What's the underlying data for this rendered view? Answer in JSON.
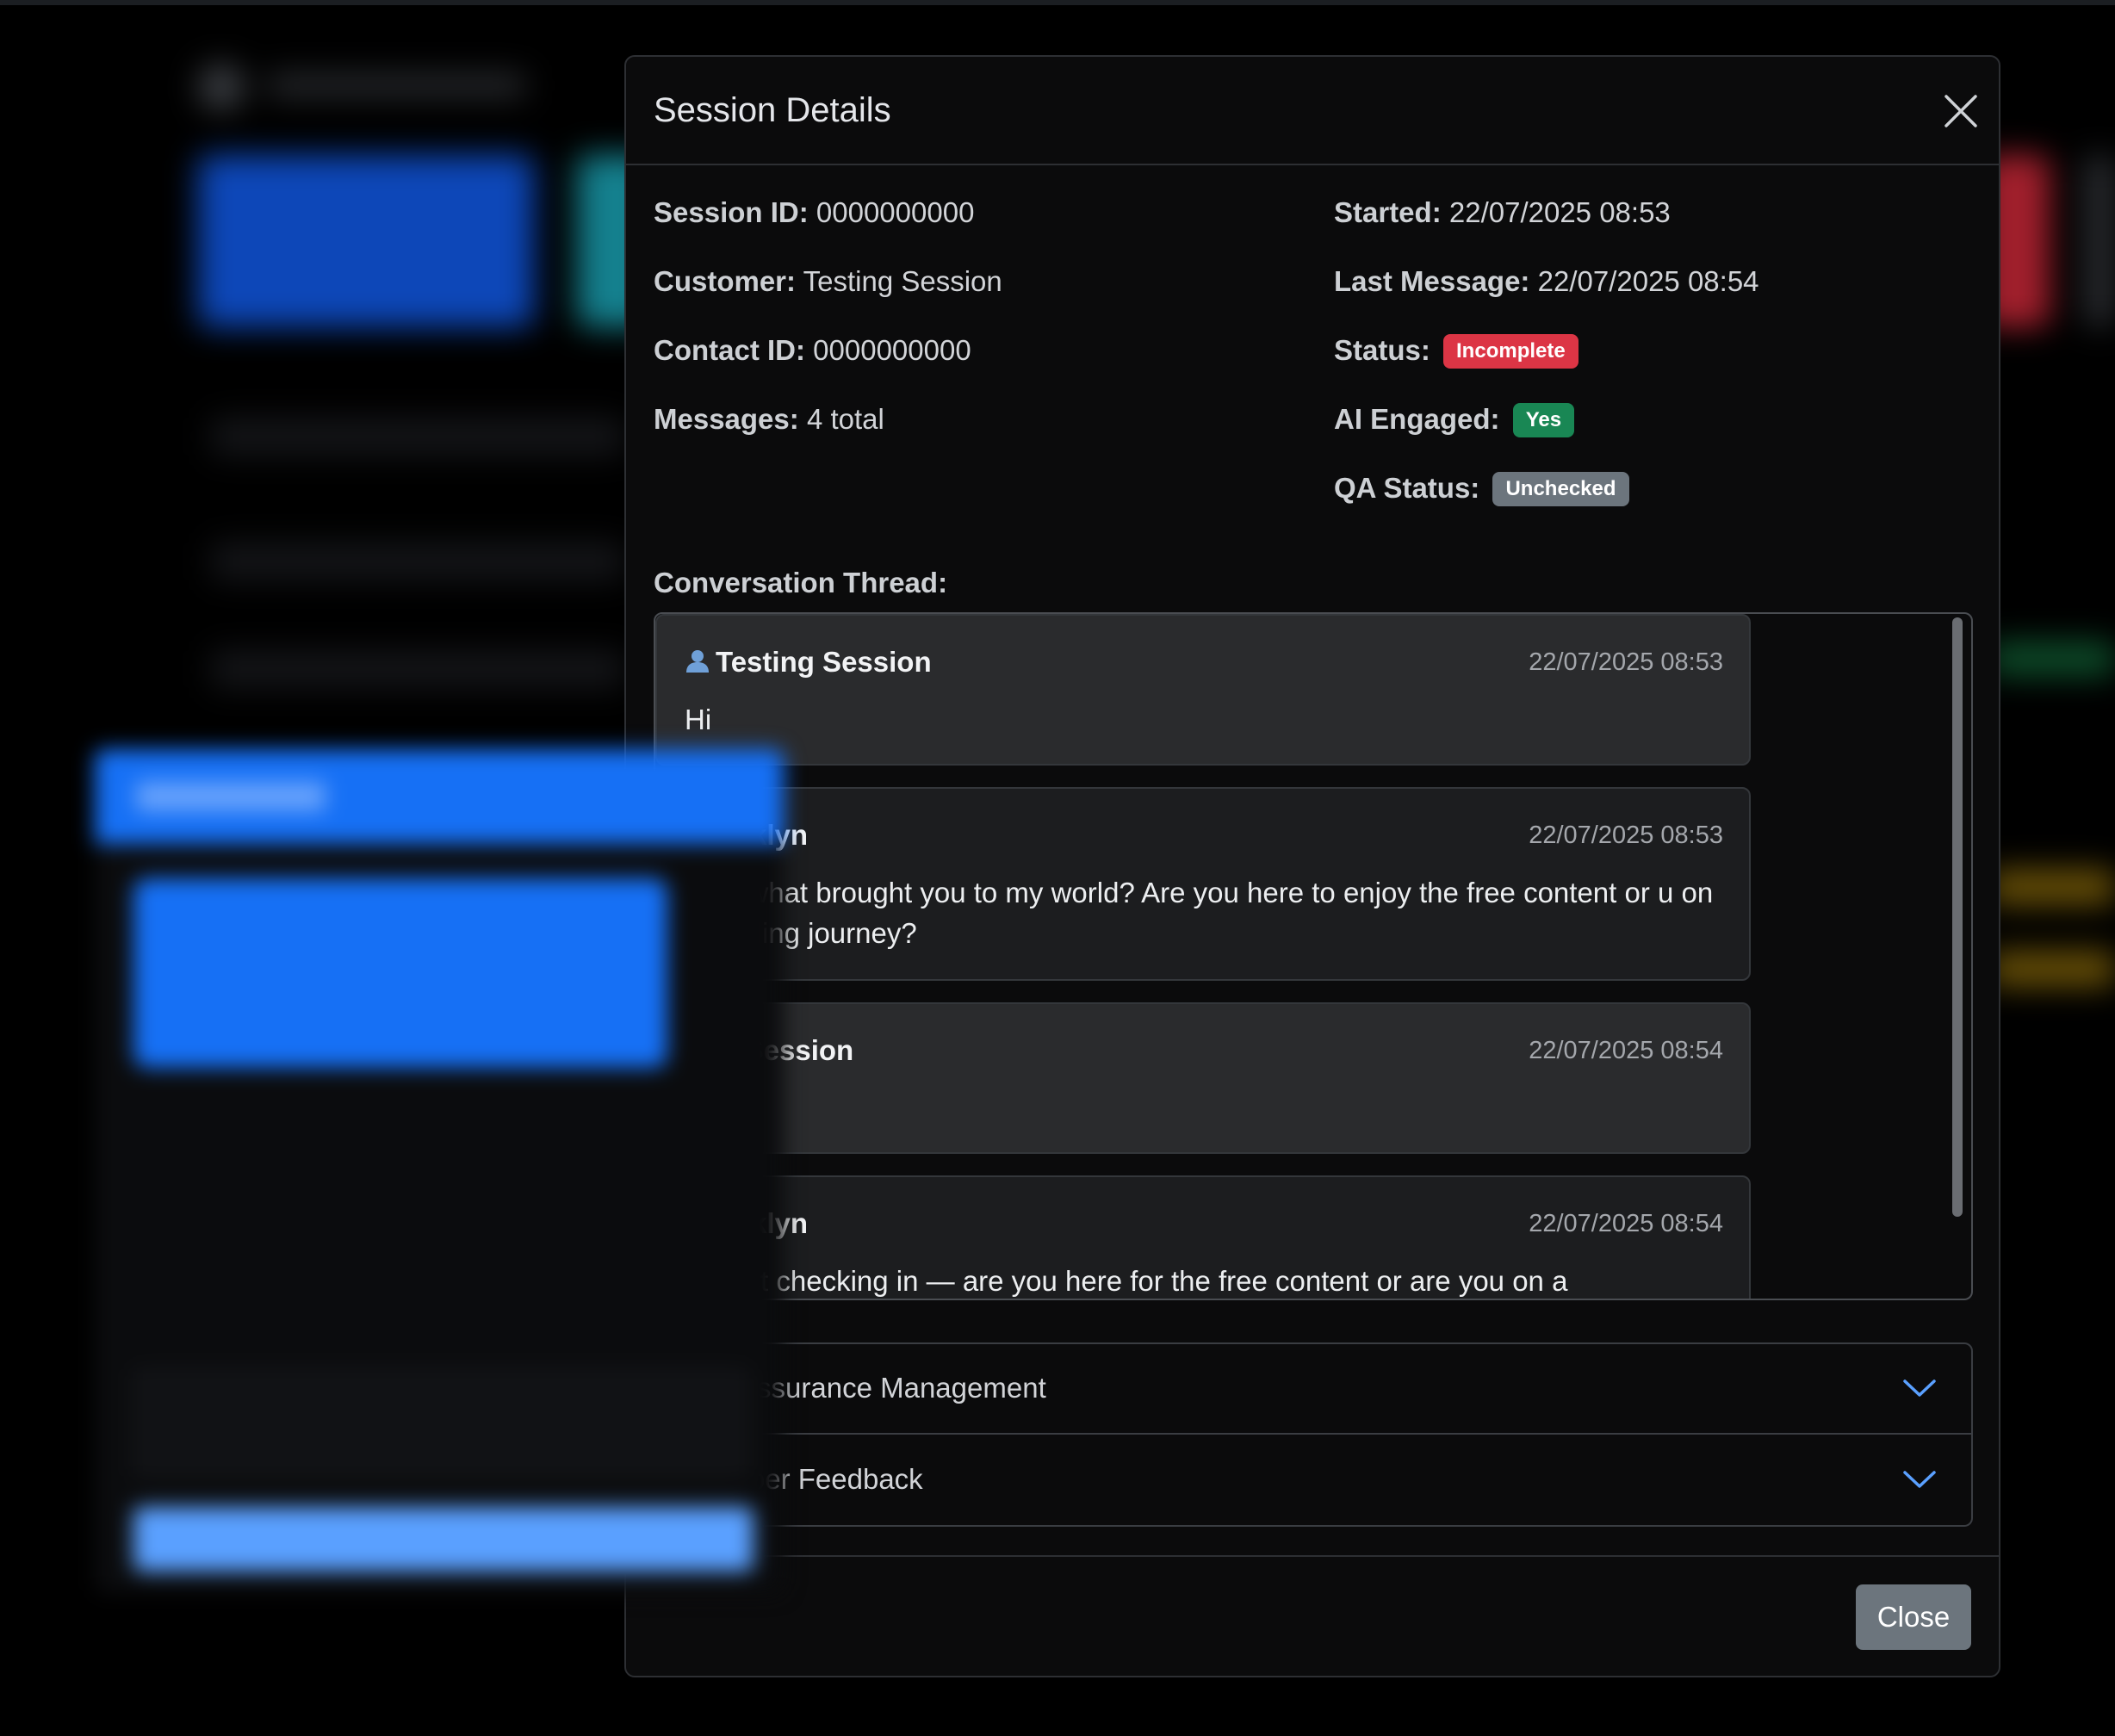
{
  "modal": {
    "title": "Session Details",
    "close_button": "Close"
  },
  "details": {
    "session_id_label": "Session ID:",
    "session_id": "0000000000",
    "customer_label": "Customer:",
    "customer": "Testing Session",
    "contact_id_label": "Contact ID:",
    "contact_id": "0000000000",
    "messages_label": "Messages:",
    "messages": "4 total",
    "started_label": "Started:",
    "started": "22/07/2025 08:53",
    "last_message_label": "Last Message:",
    "last_message": "22/07/2025 08:54",
    "status_label": "Status:",
    "status": "Incomplete",
    "ai_engaged_label": "AI Engaged:",
    "ai_engaged": "Yes",
    "qa_status_label": "QA Status:",
    "qa_status": "Unchecked"
  },
  "colors": {
    "status_badge": "#dc3545",
    "ai_badge": "#198754",
    "qa_badge": "#6c757d"
  },
  "thread": {
    "label": "Conversation Thread:",
    "messages": [
      {
        "sender": "Testing Session",
        "time": "22/07/2025 08:53",
        "text": "Hi",
        "icon": "person-icon"
      },
      {
        "sender": "Brooklyn",
        "time": "22/07/2025 08:53",
        "text": "abe, what brought you to my world? Are you here to enjoy the free content or u on a healing journey?"
      },
      {
        "sender": "ting Session",
        "time": "22/07/2025 08:54",
        "text": ""
      },
      {
        "sender": "Brooklyn",
        "time": "22/07/2025 08:54",
        "text": "n! Just checking in — are you here for the free content or are you on a"
      }
    ]
  },
  "accordion": {
    "qa_label": "ality Assurance Management",
    "feedback_label": "eveloper Feedback"
  }
}
